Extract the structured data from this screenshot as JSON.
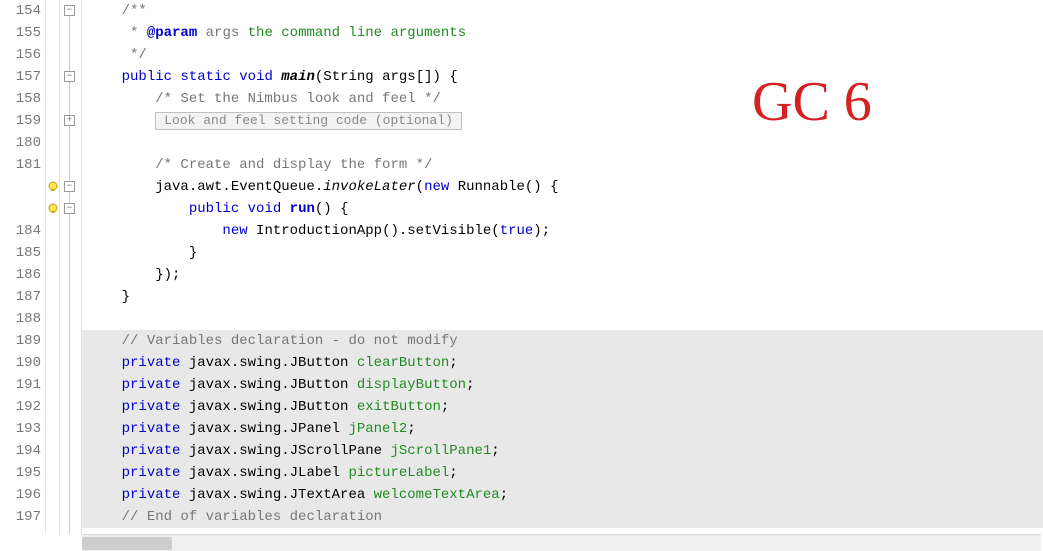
{
  "rows": [
    {
      "ln": "154",
      "fold": "minus",
      "mark": null,
      "cls": "",
      "seg": [
        {
          "c": "jdoc",
          "t": "    /**"
        }
      ]
    },
    {
      "ln": "155",
      "fold": null,
      "mark": null,
      "cls": "",
      "seg": [
        {
          "c": "jdoc",
          "t": "     * "
        },
        {
          "c": "tag",
          "t": "@param"
        },
        {
          "c": "jdoc",
          "t": " args "
        },
        {
          "c": "jtxt",
          "t": "the command line arguments"
        }
      ]
    },
    {
      "ln": "156",
      "fold": null,
      "mark": null,
      "cls": "",
      "seg": [
        {
          "c": "jdoc",
          "t": "     */"
        }
      ]
    },
    {
      "ln": "157",
      "fold": "minus",
      "mark": null,
      "cls": "",
      "seg": [
        {
          "c": "",
          "t": "    "
        },
        {
          "c": "kw",
          "t": "public"
        },
        {
          "c": "",
          "t": " "
        },
        {
          "c": "kw",
          "t": "static"
        },
        {
          "c": "",
          "t": " "
        },
        {
          "c": "kw",
          "t": "void"
        },
        {
          "c": "",
          "t": " "
        },
        {
          "c": "mname",
          "t": "main"
        },
        {
          "c": "",
          "t": "(String args[]) {"
        }
      ]
    },
    {
      "ln": "158",
      "fold": null,
      "mark": null,
      "cls": "",
      "seg": [
        {
          "c": "",
          "t": "        "
        },
        {
          "c": "com",
          "t": "/* Set the Nimbus look and feel */"
        }
      ]
    },
    {
      "ln": "159",
      "fold": "plus",
      "mark": null,
      "cls": "",
      "seg": [
        {
          "c": "",
          "t": "        "
        },
        {
          "c": "foldbox",
          "t": "Look and feel setting code (optional)"
        }
      ]
    },
    {
      "ln": "180",
      "fold": null,
      "mark": null,
      "cls": "",
      "seg": [
        {
          "c": "",
          "t": ""
        }
      ]
    },
    {
      "ln": "181",
      "fold": null,
      "mark": null,
      "cls": "",
      "seg": [
        {
          "c": "",
          "t": "        "
        },
        {
          "c": "com",
          "t": "/* Create and display the form */"
        }
      ]
    },
    {
      "ln": "",
      "fold": "minus",
      "mark": "bulb",
      "cls": "",
      "seg": [
        {
          "c": "",
          "t": "        java.awt.EventQueue."
        },
        {
          "c": "meth",
          "t": "invokeLater"
        },
        {
          "c": "",
          "t": "("
        },
        {
          "c": "kw",
          "t": "new"
        },
        {
          "c": "",
          "t": " Runnable() {"
        }
      ]
    },
    {
      "ln": "",
      "fold": "minus",
      "mark": "bulb",
      "cls": "",
      "seg": [
        {
          "c": "",
          "t": "            "
        },
        {
          "c": "kw",
          "t": "public"
        },
        {
          "c": "",
          "t": " "
        },
        {
          "c": "kw",
          "t": "void"
        },
        {
          "c": "",
          "t": " "
        },
        {
          "c": "kwb",
          "t": "run"
        },
        {
          "c": "",
          "t": "() {"
        }
      ]
    },
    {
      "ln": "184",
      "fold": null,
      "mark": null,
      "cls": "",
      "seg": [
        {
          "c": "",
          "t": "                "
        },
        {
          "c": "kw",
          "t": "new"
        },
        {
          "c": "",
          "t": " IntroductionApp().setVisible("
        },
        {
          "c": "kw",
          "t": "true"
        },
        {
          "c": "",
          "t": ");"
        }
      ]
    },
    {
      "ln": "185",
      "fold": null,
      "mark": null,
      "cls": "",
      "seg": [
        {
          "c": "",
          "t": "            }"
        }
      ]
    },
    {
      "ln": "186",
      "fold": null,
      "mark": null,
      "cls": "",
      "seg": [
        {
          "c": "",
          "t": "        });"
        }
      ]
    },
    {
      "ln": "187",
      "fold": null,
      "mark": null,
      "cls": "",
      "seg": [
        {
          "c": "",
          "t": "    }"
        }
      ]
    },
    {
      "ln": "188",
      "fold": null,
      "mark": null,
      "cls": "",
      "seg": [
        {
          "c": "",
          "t": ""
        }
      ]
    },
    {
      "ln": "189",
      "fold": null,
      "mark": null,
      "cls": "guarded",
      "seg": [
        {
          "c": "",
          "t": "    "
        },
        {
          "c": "com",
          "t": "// Variables declaration - do not modify"
        }
      ]
    },
    {
      "ln": "190",
      "fold": null,
      "mark": null,
      "cls": "guarded",
      "seg": [
        {
          "c": "",
          "t": "    "
        },
        {
          "c": "kw",
          "t": "private"
        },
        {
          "c": "",
          "t": " javax.swing.JButton "
        },
        {
          "c": "field",
          "t": "clearButton"
        },
        {
          "c": "",
          "t": ";"
        }
      ]
    },
    {
      "ln": "191",
      "fold": null,
      "mark": null,
      "cls": "guarded",
      "seg": [
        {
          "c": "",
          "t": "    "
        },
        {
          "c": "kw",
          "t": "private"
        },
        {
          "c": "",
          "t": " javax.swing.JButton "
        },
        {
          "c": "field",
          "t": "displayButton"
        },
        {
          "c": "",
          "t": ";"
        }
      ]
    },
    {
      "ln": "192",
      "fold": null,
      "mark": null,
      "cls": "guarded",
      "seg": [
        {
          "c": "",
          "t": "    "
        },
        {
          "c": "kw",
          "t": "private"
        },
        {
          "c": "",
          "t": " javax.swing.JButton "
        },
        {
          "c": "field",
          "t": "exitButton"
        },
        {
          "c": "",
          "t": ";"
        }
      ]
    },
    {
      "ln": "193",
      "fold": null,
      "mark": null,
      "cls": "guarded",
      "seg": [
        {
          "c": "",
          "t": "    "
        },
        {
          "c": "kw",
          "t": "private"
        },
        {
          "c": "",
          "t": " javax.swing.JPanel "
        },
        {
          "c": "field",
          "t": "jPanel2"
        },
        {
          "c": "",
          "t": ";"
        }
      ]
    },
    {
      "ln": "194",
      "fold": null,
      "mark": null,
      "cls": "guarded",
      "seg": [
        {
          "c": "",
          "t": "    "
        },
        {
          "c": "kw",
          "t": "private"
        },
        {
          "c": "",
          "t": " javax.swing.JScrollPane "
        },
        {
          "c": "field",
          "t": "jScrollPane1"
        },
        {
          "c": "",
          "t": ";"
        }
      ]
    },
    {
      "ln": "195",
      "fold": null,
      "mark": null,
      "cls": "guarded",
      "seg": [
        {
          "c": "",
          "t": "    "
        },
        {
          "c": "kw",
          "t": "private"
        },
        {
          "c": "",
          "t": " javax.swing.JLabel "
        },
        {
          "c": "field",
          "t": "pictureLabel"
        },
        {
          "c": "",
          "t": ";"
        }
      ]
    },
    {
      "ln": "196",
      "fold": null,
      "mark": null,
      "cls": "guarded",
      "seg": [
        {
          "c": "",
          "t": "    "
        },
        {
          "c": "kw",
          "t": "private"
        },
        {
          "c": "",
          "t": " javax.swing.JTextArea "
        },
        {
          "c": "field",
          "t": "welcomeTextArea"
        },
        {
          "c": "",
          "t": ";"
        }
      ]
    },
    {
      "ln": "197",
      "fold": null,
      "mark": null,
      "cls": "guarded",
      "seg": [
        {
          "c": "",
          "t": "    "
        },
        {
          "c": "com",
          "t": "// End of variables declaration"
        }
      ]
    }
  ],
  "annotation": {
    "text": "GC 6"
  }
}
